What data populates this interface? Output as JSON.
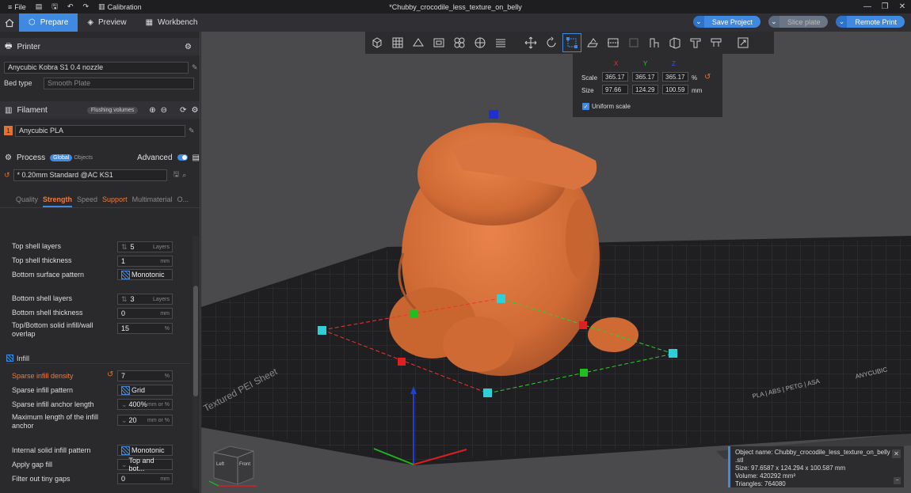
{
  "titlebar": {
    "menu_file": "File",
    "menu_calibration": "Calibration",
    "doc_title": "*Chubby_crocodile_less_texture_on_belly"
  },
  "toolbar": {
    "tabs": [
      {
        "label": "Prepare"
      },
      {
        "label": "Preview"
      },
      {
        "label": "Workbench"
      }
    ],
    "save_project": "Save Project",
    "slice_plate": "Slice plate",
    "remote_print": "Remote Print"
  },
  "printer": {
    "header": "Printer",
    "name": "Anycubic Kobra S1 0.4 nozzle",
    "bed_type_label": "Bed type",
    "bed_type_value": "Smooth Plate"
  },
  "filament": {
    "header": "Filament",
    "flushing_volumes": "Flushing volumes",
    "slot_number": "1",
    "name": "Anycubic PLA"
  },
  "process": {
    "header": "Process",
    "global": "Global",
    "objects": "Objects",
    "advanced": "Advanced",
    "preset": "* 0.20mm Standard @AC KS1",
    "tabs": [
      "Quality",
      "Strength",
      "Speed",
      "Support",
      "Multimaterial",
      "O..."
    ]
  },
  "settings": {
    "top_shell_layers_label": "Top shell layers",
    "top_shell_layers_value": "5",
    "top_shell_layers_unit": "Layers",
    "top_shell_thickness_label": "Top shell thickness",
    "top_shell_thickness_value": "1",
    "unit_mm": "mm",
    "bottom_surface_pattern_label": "Bottom surface pattern",
    "bottom_surface_pattern_value": "Monotonic",
    "bottom_shell_layers_label": "Bottom shell layers",
    "bottom_shell_layers_value": "3",
    "bottom_shell_layers_unit": "Layers",
    "bottom_shell_thickness_label": "Bottom shell thickness",
    "bottom_shell_thickness_value": "0",
    "solid_infill_label_1": "Top/Bottom solid infill/wall",
    "solid_infill_label_2": "overlap",
    "solid_infill_value": "15",
    "unit_pct": "%",
    "infill_header": "Infill",
    "sparse_density_label": "Sparse infill density",
    "sparse_density_value": "7",
    "sparse_pattern_label": "Sparse infill pattern",
    "sparse_pattern_value": "Grid",
    "anchor_length_label": "Sparse infill anchor length",
    "anchor_length_value": "400%",
    "unit_mm_or_pct": "mm or %",
    "max_anchor_label_1": "Maximum length of the infill",
    "max_anchor_label_2": "anchor",
    "max_anchor_value": "20",
    "internal_solid_label": "Internal solid infill pattern",
    "internal_solid_value": "Monotonic",
    "gap_fill_label": "Apply gap fill",
    "gap_fill_value": "Top and bot...",
    "filter_gaps_label": "Filter out tiny gaps",
    "filter_gaps_value": "0"
  },
  "scale_panel": {
    "x": "X",
    "y": "Y",
    "z": "Z",
    "scale_label": "Scale",
    "scale_x": "365.17",
    "scale_y": "365.17",
    "scale_z": "365.17",
    "pct": "%",
    "size_label": "Size",
    "size_x": "97.66",
    "size_y": "124.29",
    "size_z": "100.59",
    "mm": "mm",
    "uniform": "Uniform scale"
  },
  "object_info": {
    "name_line": "Object name: Chubby_crocodile_less_texture_on_belly",
    "name_line2": ".stl",
    "size": "Size: 97.6587 x 124.294 x 100.587 mm",
    "volume": "Volume: 420292 mm³",
    "triangles": "Triangles: 764080"
  },
  "plate": {
    "label_left": "Textured PEI Sheet",
    "label_right": "PLA | ABS | PETG | ASA",
    "brand": "ANYCUBIC"
  },
  "viewcube": {
    "left": "Left",
    "front": "Front"
  },
  "colors": {
    "accent": "#3f8ae0",
    "model": "#d9733f",
    "highlight": "#f07a3a"
  }
}
